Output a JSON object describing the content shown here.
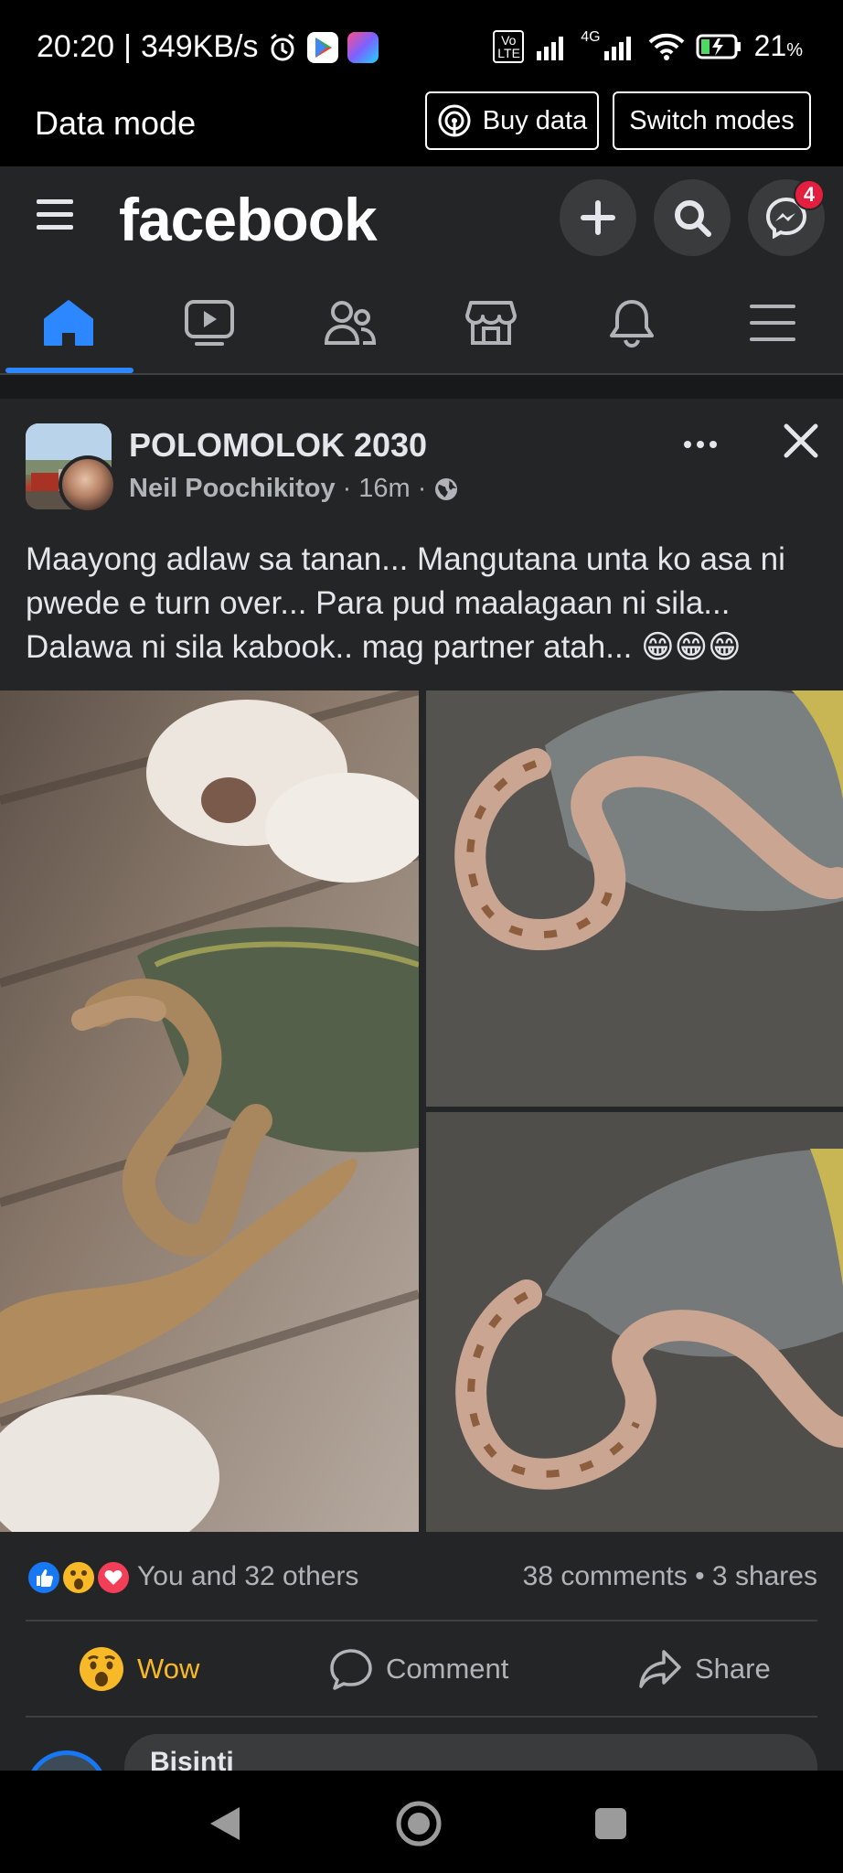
{
  "status_bar": {
    "time": "20:20",
    "speed": "349KB/s",
    "separator": "|",
    "volte": "Vo LTE",
    "network": "4G",
    "battery": "21",
    "battery_unit": "%"
  },
  "data_mode": {
    "label": "Data mode",
    "buy_data": "Buy data",
    "switch_modes": "Switch modes"
  },
  "header": {
    "logo": "facebook",
    "messenger_badge": "4",
    "icons": [
      "menu-icon",
      "plus-icon",
      "search-icon",
      "messenger-icon"
    ]
  },
  "nav": {
    "tabs": [
      "home-icon",
      "video-icon",
      "friends-icon",
      "marketplace-icon",
      "bell-icon",
      "menu-icon"
    ],
    "active_index": 0
  },
  "post": {
    "group_name": "POLOMOLOK 2030",
    "author": "Neil Poochikitoy",
    "separator": "·",
    "time": "16m",
    "text": "Maayong adlaw sa tanan... Mangutana unta ko asa ni pwede e turn over... Para pud maalagaan ni sila... Dalawa ni sila kabook.. mag partner atah... 😁😁😁",
    "reactions_text": "You and 32 others",
    "comments": "38 comments",
    "dot": "•",
    "shares": "3 shares",
    "actions": {
      "wow": "Wow",
      "comment": "Comment",
      "share": "Share"
    },
    "commenter_name": "Bisinti"
  },
  "colors": {
    "background": "#242526",
    "accent": "#2d88ff",
    "wow": "#f7b928",
    "badge": "#e41e3f"
  }
}
